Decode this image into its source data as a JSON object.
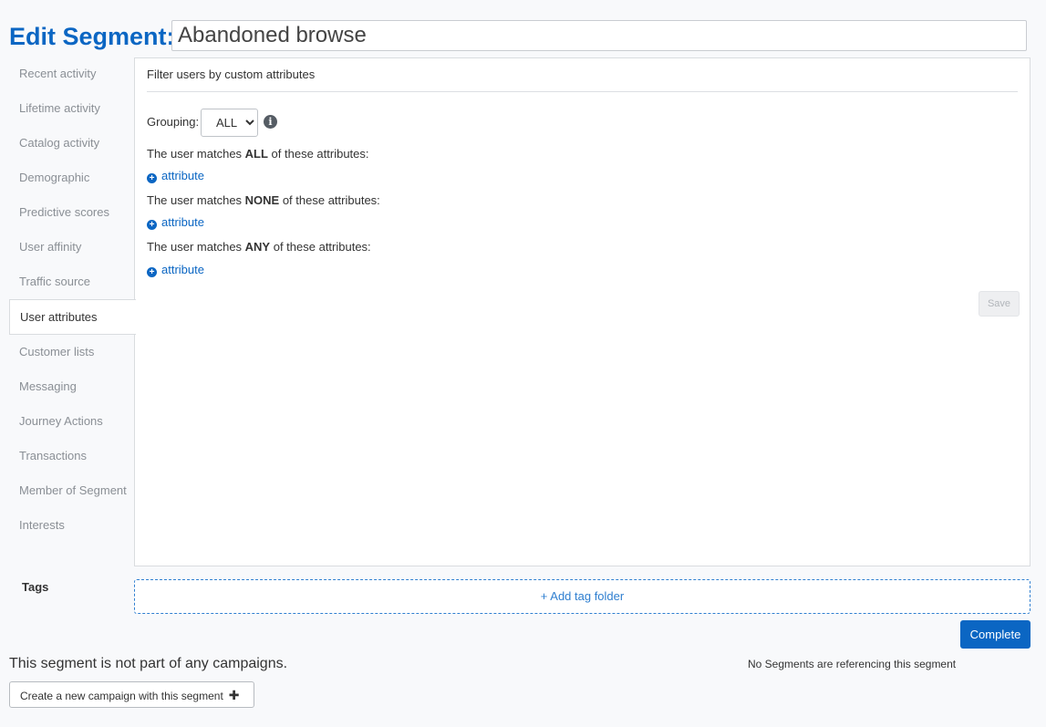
{
  "header": {
    "title": "Edit Segment:",
    "segment_name": "Abandoned browse"
  },
  "sidebar": {
    "items": [
      {
        "label": "Recent activity"
      },
      {
        "label": "Lifetime activity"
      },
      {
        "label": "Catalog activity"
      },
      {
        "label": "Demographic"
      },
      {
        "label": "Predictive scores"
      },
      {
        "label": "User affinity"
      },
      {
        "label": "Traffic source"
      },
      {
        "label": "User attributes",
        "active": true
      },
      {
        "label": "Customer lists"
      },
      {
        "label": "Messaging"
      },
      {
        "label": "Journey Actions"
      },
      {
        "label": "Transactions"
      },
      {
        "label": "Member of Segment"
      },
      {
        "label": "Interests"
      }
    ]
  },
  "panel": {
    "title": "Filter users by custom attributes",
    "grouping_label": "Grouping:",
    "grouping_value": "ALL",
    "info_icon": "info-circle-icon",
    "groups": [
      {
        "prefix": "The user matches ",
        "keyword": "ALL",
        "suffix": " of these attributes:",
        "link": "attribute"
      },
      {
        "prefix": "The user matches ",
        "keyword": "NONE",
        "suffix": " of these attributes:",
        "link": "attribute"
      },
      {
        "prefix": "The user matches ",
        "keyword": "ANY",
        "suffix": " of these attributes:",
        "link": "attribute"
      }
    ],
    "save_label": "Save"
  },
  "tags": {
    "label": "Tags",
    "add_folder": "+ Add tag folder"
  },
  "footer": {
    "complete_label": "Complete",
    "campaign_status": "This segment is not part of any campaigns.",
    "reference_status": "No Segments are referencing this segment",
    "create_campaign": "Create a new campaign with this segment"
  },
  "colors": {
    "accent": "#0b66c3",
    "panel_border": "#d9dcdf"
  }
}
